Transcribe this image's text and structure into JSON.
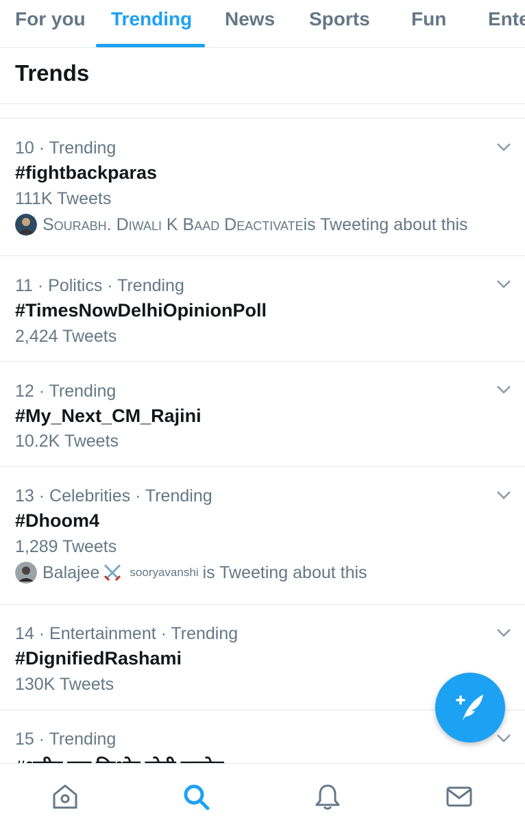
{
  "tabs": [
    {
      "label": "For you",
      "active": false
    },
    {
      "label": "Trending",
      "active": true
    },
    {
      "label": "News",
      "active": false
    },
    {
      "label": "Sports",
      "active": false
    },
    {
      "label": "Fun",
      "active": false
    },
    {
      "label": "Ente",
      "active": false
    }
  ],
  "section_title": "Trends",
  "trends": [
    {
      "meta": "10 · Trending",
      "tag": "#fightbackparas",
      "count": "111K Tweets",
      "about_user": "Sourabh. Diwali K Baad Deactivate",
      "about_suffix": " is Tweeting about this"
    },
    {
      "meta": "11 · Politics · Trending",
      "tag": "#TimesNowDelhiOpinionPoll",
      "count": "2,424 Tweets"
    },
    {
      "meta": "12 · Trending",
      "tag": "#My_Next_CM_Rajini",
      "count": "10.2K Tweets"
    },
    {
      "meta": "13 · Celebrities · Trending",
      "tag": "#Dhoom4",
      "count": "1,289 Tweets",
      "about_user": "Balajee",
      "about_super": "sooryavanshi",
      "about_suffix": " is Tweeting about this"
    },
    {
      "meta": "14 · Entertainment · Trending",
      "tag": "#DignifiedRashami",
      "count": "130K Tweets"
    },
    {
      "meta": "15 · Trending",
      "tag": "#शहीद राम किशोर मोदी खारोग"
    }
  ],
  "icons": {
    "chevron": "chevron-down-icon",
    "compose": "compose-tweet-icon",
    "home": "home-icon",
    "search": "search-icon",
    "notifications": "bell-icon",
    "messages": "mail-icon"
  },
  "colors": {
    "accent": "#1da1f2",
    "text_primary": "#14171a",
    "text_secondary": "#657786",
    "divider": "#e1e8ed"
  }
}
